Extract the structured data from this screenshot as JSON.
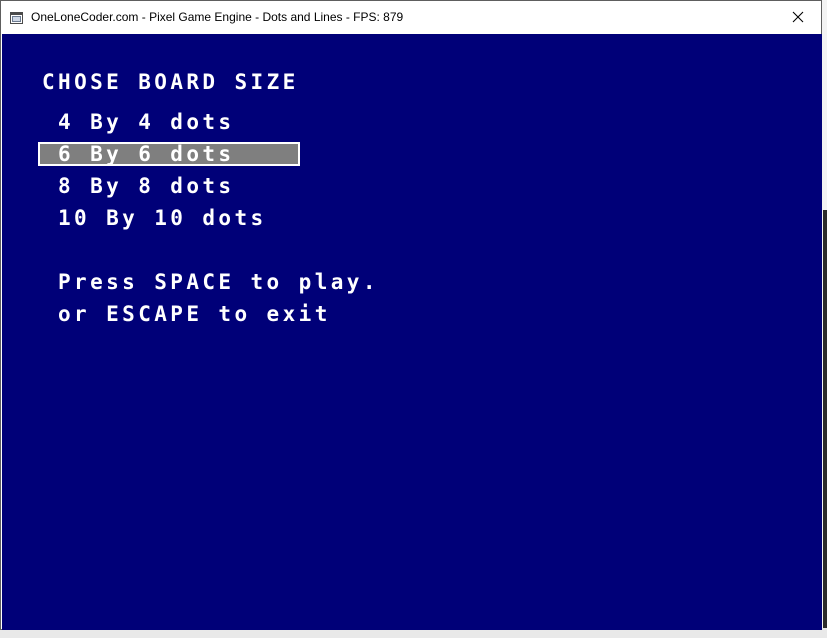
{
  "window": {
    "title": "OneLoneCoder.com - Pixel Game Engine - Dots and Lines - FPS: 879",
    "background_color": "#000078",
    "text_color": "#ffffff",
    "highlight_color": "#7f7f7f"
  },
  "icons": {
    "app": "app-window-icon",
    "close": "close-icon"
  },
  "menu": {
    "heading": "CHOSE BOARD SIZE",
    "options": [
      "4 By 4 dots",
      "6 By 6 dots",
      "8 By 8 dots",
      "10 By 10 dots"
    ],
    "selected_option": "6 By 6 dots"
  },
  "instructions": {
    "line1": "Press SPACE to play.",
    "line2": "or ESCAPE to exit"
  }
}
